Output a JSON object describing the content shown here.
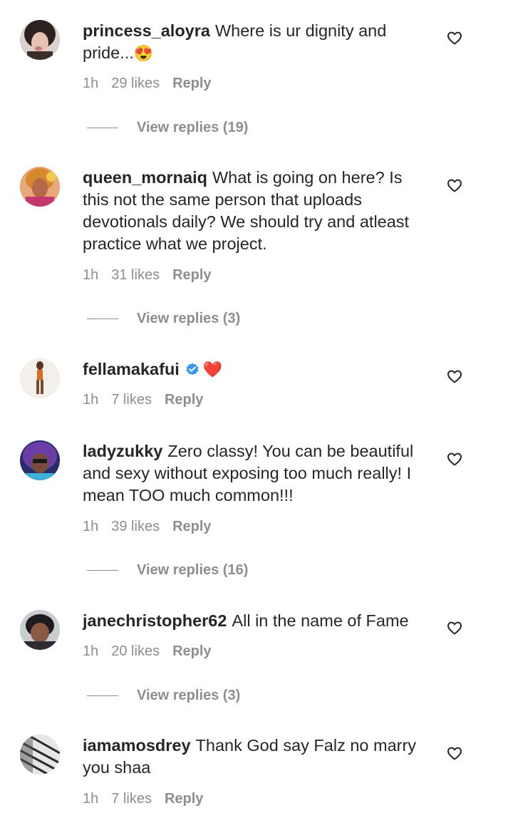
{
  "comments": [
    {
      "username": "princess_aloyra",
      "text": "Where is ur dignity and pride...",
      "emoji": "😍",
      "time": "1h",
      "likes": "29 likes",
      "reply": "Reply",
      "view_replies": "View replies (19)"
    },
    {
      "username": "queen_mornaiq",
      "text": "What is going on here? Is this not the same person that uploads devotionals daily? We should try and atleast practice what we project.",
      "time": "1h",
      "likes": "31 likes",
      "reply": "Reply",
      "view_replies": "View replies (3)"
    },
    {
      "username": "fellamakafui",
      "text": "",
      "emoji": "❤️",
      "verified": true,
      "time": "1h",
      "likes": "7 likes",
      "reply": "Reply"
    },
    {
      "username": "ladyzukky",
      "text": "Zero classy! You can be beautiful and sexy without exposing too much really! I mean TOO much common!!!",
      "time": "1h",
      "likes": "39 likes",
      "reply": "Reply",
      "view_replies": "View replies (16)"
    },
    {
      "username": "janechristopher62",
      "text": "All in the name of Fame",
      "time": "1h",
      "likes": "20 likes",
      "reply": "Reply",
      "view_replies": "View replies (3)"
    },
    {
      "username": "iamamosdrey",
      "text": "Thank God say Falz no marry you shaa",
      "time": "1h",
      "likes": "7 likes",
      "reply": "Reply"
    }
  ],
  "colors": {
    "text": "#262626",
    "secondary": "#8e8e8e",
    "verified": "#3897f0",
    "heart_emoji": "#ed1c24"
  },
  "icons": {
    "like": "heart-outline-icon",
    "verified": "verified-badge-icon"
  }
}
